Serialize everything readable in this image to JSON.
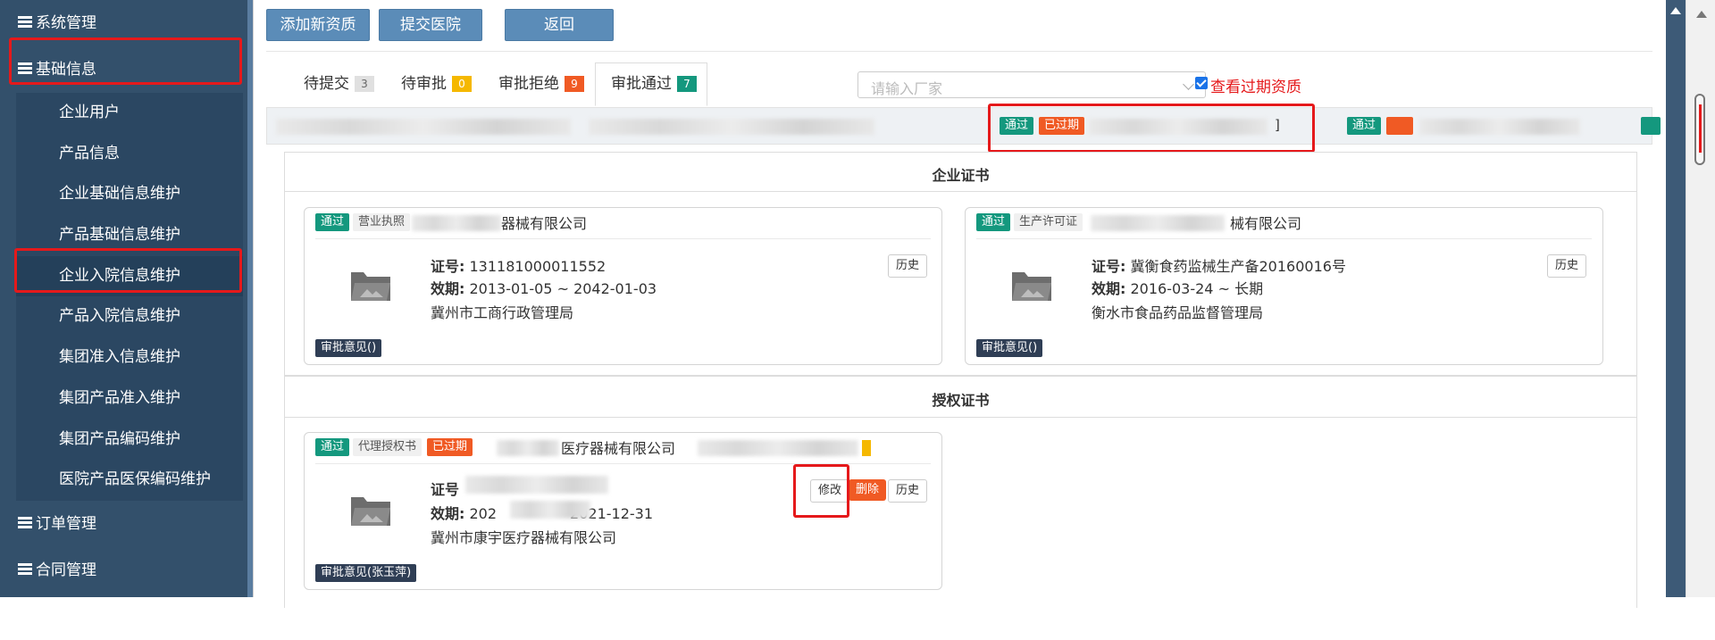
{
  "sidebar": {
    "items": [
      {
        "label": "系统管理",
        "level": 1
      },
      {
        "label": "基础信息",
        "level": 1
      },
      {
        "label": "企业用户",
        "level": 2
      },
      {
        "label": "产品信息",
        "level": 2
      },
      {
        "label": "企业基础信息维护",
        "level": 2
      },
      {
        "label": "产品基础信息维护",
        "level": 2
      },
      {
        "label": "企业入院信息维护",
        "level": 2
      },
      {
        "label": "产品入院信息维护",
        "level": 2
      },
      {
        "label": "集团准入信息维护",
        "level": 2
      },
      {
        "label": "集团产品准入维护",
        "level": 2
      },
      {
        "label": "集团产品编码维护",
        "level": 2
      },
      {
        "label": "医院产品医保编码维护",
        "level": 2
      },
      {
        "label": "订单管理",
        "level": 1
      },
      {
        "label": "合同管理",
        "level": 1
      }
    ]
  },
  "toolbar": {
    "add_label": "添加新资质",
    "submit_label": "提交医院",
    "back_label": "返回"
  },
  "tabs": [
    {
      "label": "待提交",
      "count": "3",
      "badge_color": "#e0e0e0",
      "badge_text": "#666"
    },
    {
      "label": "待审批",
      "count": "0",
      "badge_color": "#f5b800",
      "badge_text": "#fff"
    },
    {
      "label": "审批拒绝",
      "count": "9",
      "badge_color": "#f05a24",
      "badge_text": "#fff"
    },
    {
      "label": "审批通过",
      "count": "7",
      "badge_color": "#14987e",
      "badge_text": "#fff"
    }
  ],
  "filter": {
    "placeholder": "请输入厂家",
    "expired_label": "查看过期资质"
  },
  "strip": {
    "tag_pass": "通过",
    "tag_expired": "已过期",
    "bracket": "]"
  },
  "sections": {
    "enterprise_title": "企业证书",
    "auth_title": "授权证书"
  },
  "cards": {
    "biz": {
      "status": "通过",
      "type": "营业执照",
      "name_suffix": "器械有限公司",
      "cert_label": "证号:",
      "cert_no": "131181000011552",
      "valid_label": "效期:",
      "valid": "2013-01-05 ~ 2042-01-03",
      "issuer": "冀州市工商行政管理局",
      "history": "历史",
      "opinion": "审批意见()"
    },
    "prod": {
      "status": "通过",
      "type": "生产许可证",
      "name_suffix": "械有限公司",
      "cert_label": "证号:",
      "cert_no": "冀衡食药监械生产备20160016号",
      "valid_label": "效期:",
      "valid": "2016-03-24 ~ 长期",
      "issuer": "衡水市食品药品监督管理局",
      "history": "历史",
      "opinion": "审批意见()"
    },
    "auth": {
      "status": "通过",
      "type": "代理授权书",
      "expired": "已过期",
      "name_suffix": "医疗器械有限公司",
      "cert_label": "证号",
      "valid_label": "效期:",
      "valid_start": "202",
      "valid_end": "2021-12-31",
      "issuer": "冀州市康宇医疗器械有限公司",
      "edit": "修改",
      "delete": "删除",
      "history": "历史",
      "opinion": "审批意见(张玉萍)"
    }
  },
  "colors": {
    "sidebar": "#33506b",
    "accent": "#5b8cb8",
    "pass": "#14987e",
    "expired": "#f05a24",
    "highlight": "#e5191b"
  }
}
